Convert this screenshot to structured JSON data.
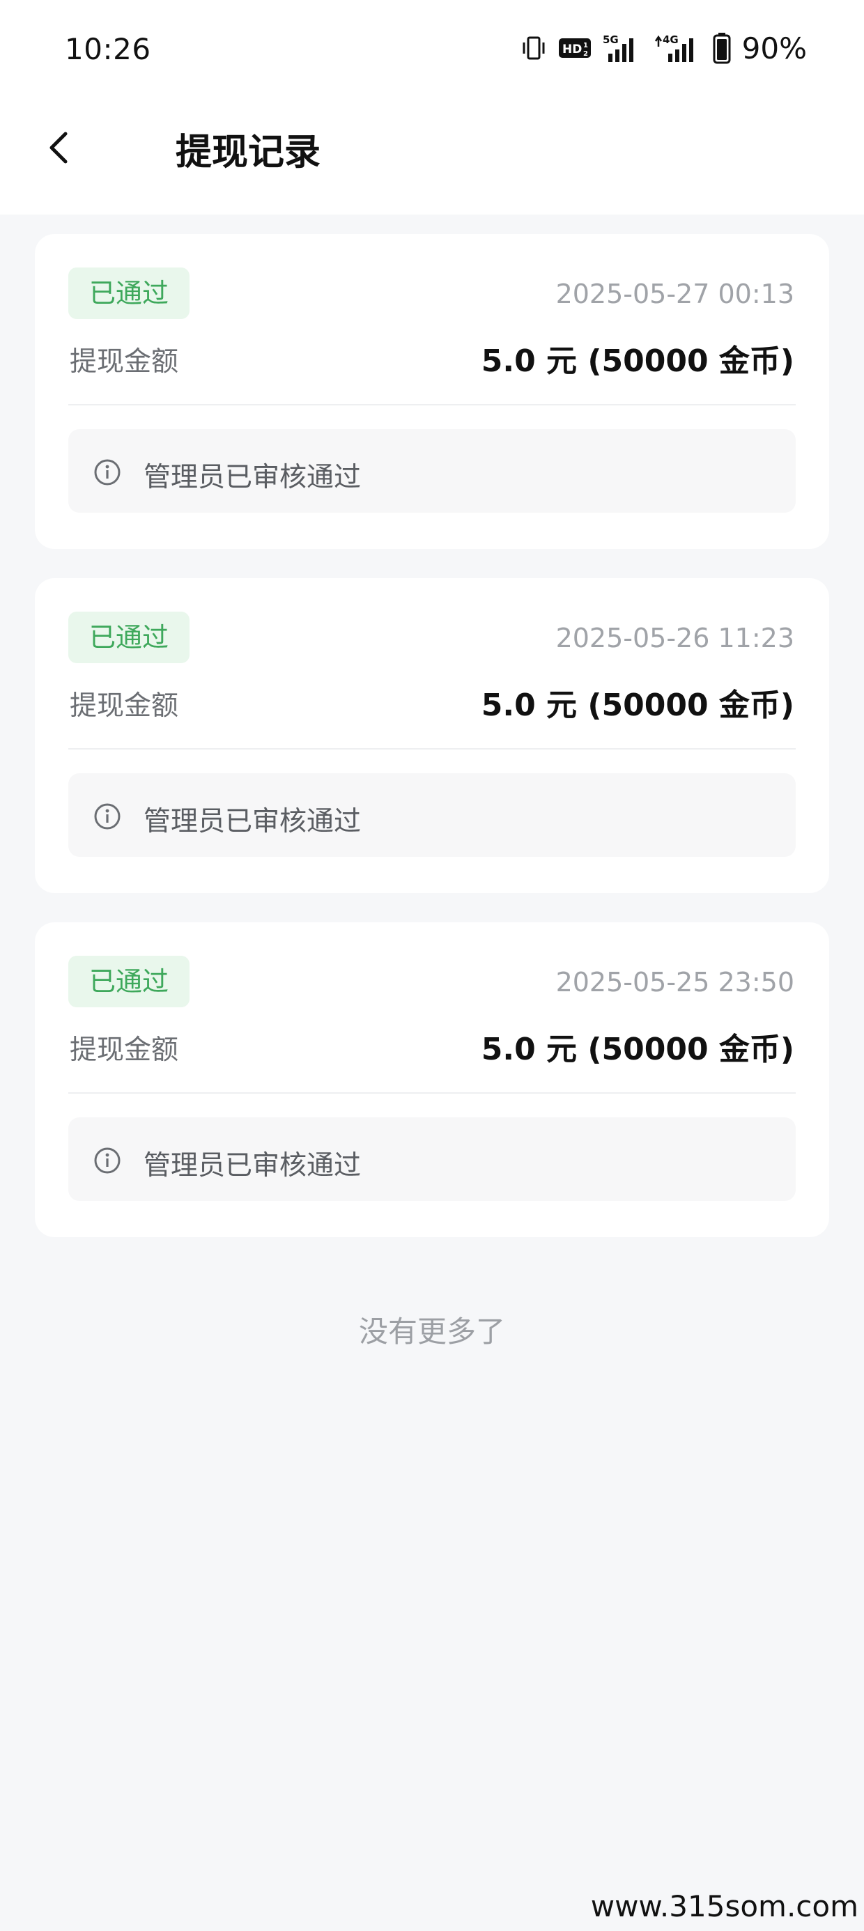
{
  "status_bar": {
    "time": "10:26",
    "battery": "90%",
    "icons": [
      "vibrate-icon",
      "hd-voice-icon",
      "5g-signal-icon",
      "4g-signal-icon",
      "battery-icon"
    ]
  },
  "header": {
    "title": "提现记录",
    "back_icon": "chevron-left-icon"
  },
  "records": [
    {
      "status": "已通过",
      "time": "2025-05-27 00:13",
      "amount_label": "提现金额",
      "amount": "5.0 元 (50000 金币)",
      "note": "管理员已审核通过"
    },
    {
      "status": "已通过",
      "time": "2025-05-26 11:23",
      "amount_label": "提现金额",
      "amount": "5.0 元 (50000 金币)",
      "note": "管理员已审核通过"
    },
    {
      "status": "已通过",
      "time": "2025-05-25 23:50",
      "amount_label": "提现金额",
      "amount": "5.0 元 (50000 金币)",
      "note": "管理员已审核通过"
    }
  ],
  "footer": {
    "no_more": "没有更多了"
  },
  "watermark": "www.315som.com",
  "colors": {
    "approved_text": "#3ea85b",
    "approved_bg": "#e9f7ec",
    "page_bg": "#f6f7f9"
  }
}
